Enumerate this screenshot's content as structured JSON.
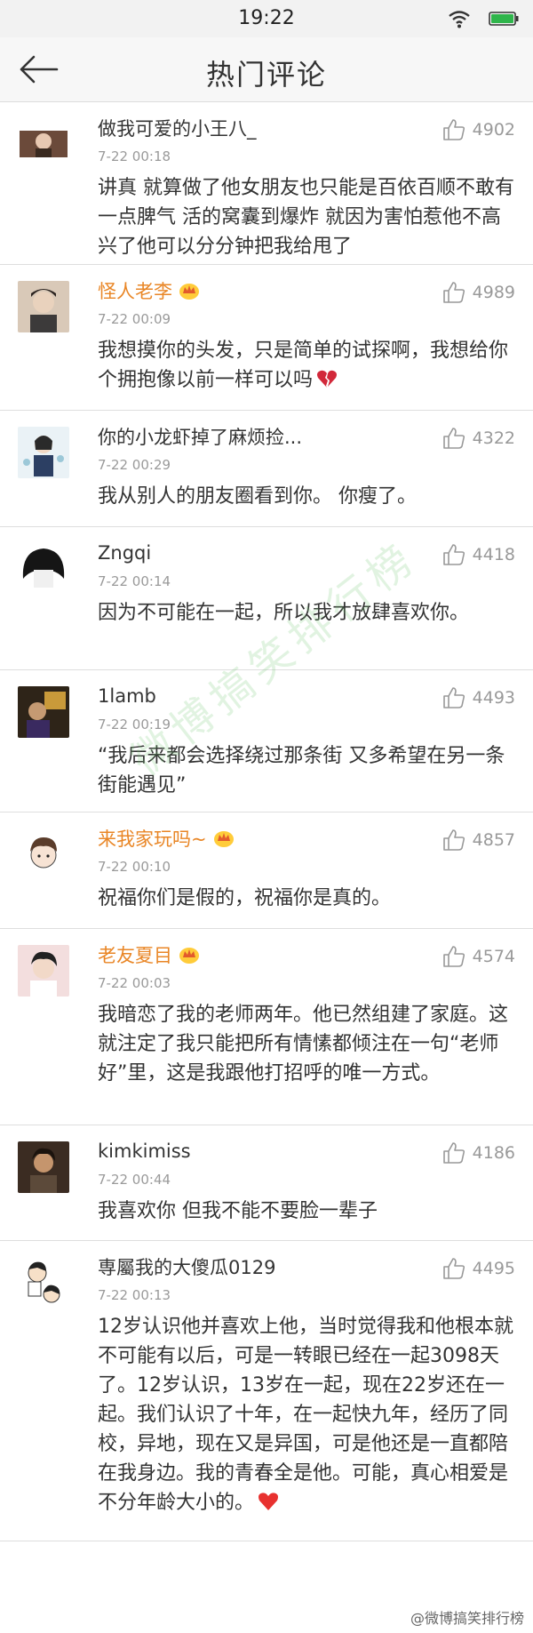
{
  "status_bar": {
    "time": "19:22"
  },
  "header": {
    "title": "热门评论"
  },
  "comments": [
    {
      "user": "做我可爱的小王八_",
      "time": "7-22 00:18",
      "likes": "4902",
      "vip": false,
      "text": "讲真 就算做了他女朋友也只能是百依百顺不敢有一点脾气 活的窝囊到爆炸 就因为害怕惹他不高兴了他可以分分钟把我给甩了"
    },
    {
      "user": "怪人老李",
      "time": "7-22 00:09",
      "likes": "4989",
      "vip": true,
      "text": "我想摸你的头发，只是简单的试探啊，我想给你个拥抱像以前一样可以吗",
      "emoji": "broken-heart"
    },
    {
      "user": "你的小龙虾掉了麻烦捡...",
      "time": "7-22 00:29",
      "likes": "4322",
      "vip": false,
      "text": "我从别人的朋友圈看到你。 你瘦了。"
    },
    {
      "user": "Zngqi",
      "time": "7-22 00:14",
      "likes": "4418",
      "vip": false,
      "text": "因为不可能在一起，所以我才放肆喜欢你。"
    },
    {
      "user": "1lamb",
      "time": "7-22 00:19",
      "likes": "4493",
      "vip": false,
      "text": "“我后来都会选择绕过那条街 又多希望在另一条街能遇见”"
    },
    {
      "user": "来我家玩吗~",
      "time": "7-22 00:10",
      "likes": "4857",
      "vip": true,
      "text": "祝福你们是假的，祝福你是真的。"
    },
    {
      "user": "老友夏目",
      "time": "7-22 00:03",
      "likes": "4574",
      "vip": true,
      "text": "我暗恋了我的老师两年。他已然组建了家庭。这就注定了我只能把所有情愫都倾注在一句“老师好”里，这是我跟他打招呼的唯一方式。"
    },
    {
      "user": "kimkimiss",
      "time": "7-22 00:44",
      "likes": "4186",
      "vip": false,
      "text": "我喜欢你 但我不能不要脸一辈子"
    },
    {
      "user": "専屬我的大傻瓜0129",
      "time": "7-22 00:13",
      "likes": "4495",
      "vip": false,
      "text": "12岁认识他并喜欢上他，当时觉得我和他根本就不可能有以后，可是一转眼已经在一起3098天了。12岁认识，13岁在一起，现在22岁还在一起。我们认识了十年，在一起快九年，经历了同校，异地，现在又是异国，可是他还是一直都陪在我身边。我的青春全是他。可能，真心相爱是不分年龄大小的。",
      "emoji": "red-heart"
    }
  ],
  "watermark": "微博搞笑排行榜",
  "footer_mark": "@微博搞笑排行榜",
  "colors": {
    "vip_name": "#e98626",
    "text": "#333333",
    "meta": "#9a9a9a",
    "divider": "#dedede"
  }
}
